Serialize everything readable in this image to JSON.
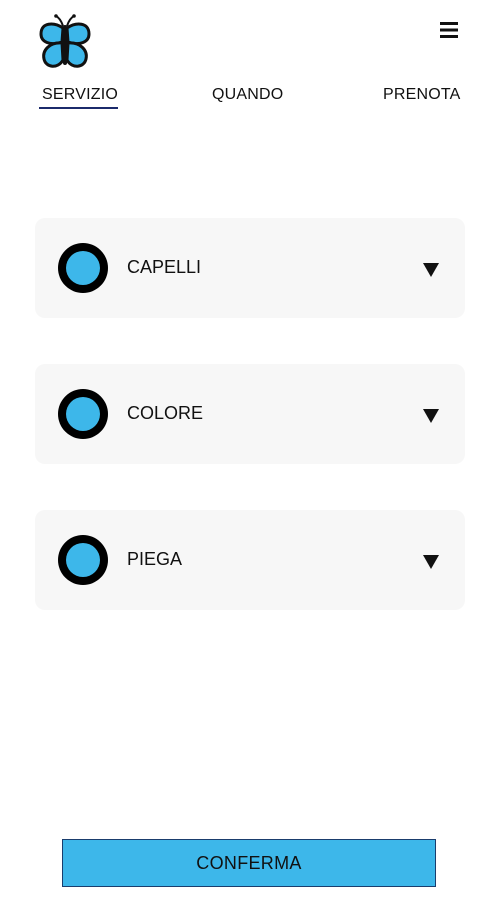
{
  "header": {
    "logo_icon": "butterfly-logo-icon",
    "menu_icon": "hamburger-menu-icon"
  },
  "tabs": [
    {
      "label": "SERVIZIO",
      "active": true
    },
    {
      "label": "QUANDO",
      "active": false
    },
    {
      "label": "PRENOTA",
      "active": false
    }
  ],
  "services": [
    {
      "label": "CAPELLI",
      "expand_icon": "caret-down-icon"
    },
    {
      "label": "COLORE",
      "expand_icon": "caret-down-icon"
    },
    {
      "label": "PIEGA",
      "expand_icon": "caret-down-icon"
    }
  ],
  "confirm_button": {
    "label": "CONFERMA"
  },
  "colors": {
    "accent": "#3db7ea",
    "active_tab_underline": "#1b2a6b",
    "card_background": "#f7f7f7",
    "button_border": "#1a3d6d"
  }
}
